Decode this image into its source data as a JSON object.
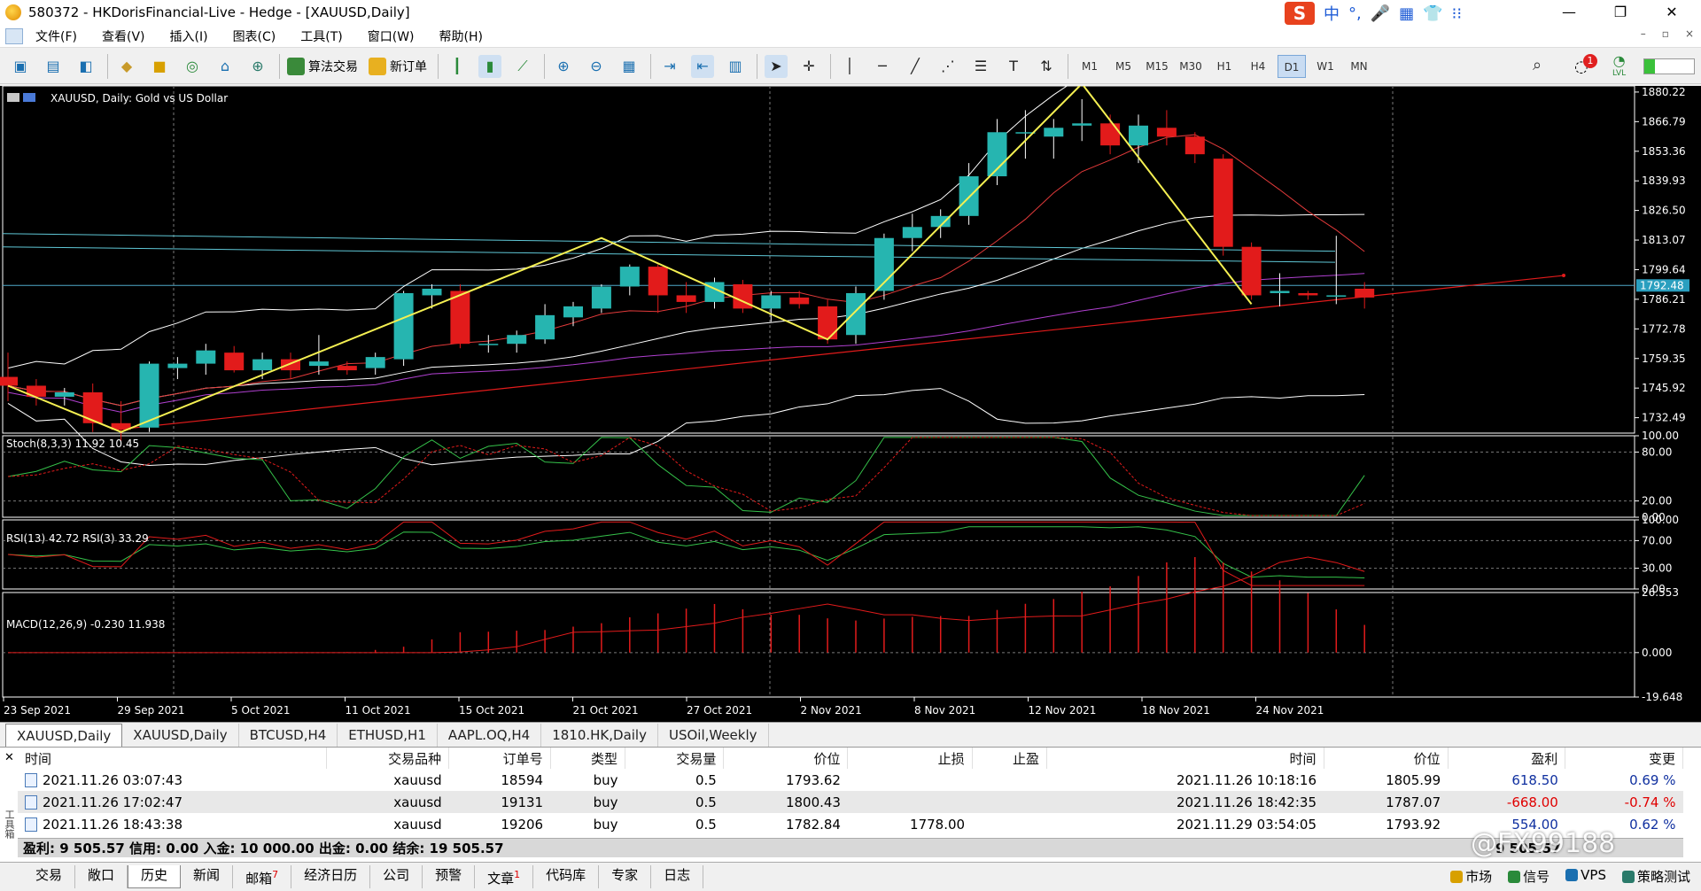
{
  "window": {
    "title": "580372 - HKDorisFinancial-Live - Hedge - [XAUUSD,Daily]",
    "minimize": "—",
    "restore": "❐",
    "close": "✕"
  },
  "ime": {
    "logo": "S",
    "items": [
      "中",
      "°,",
      "🎤",
      "▦",
      "👕",
      "⁝⁝"
    ]
  },
  "menu": [
    "文件(F)",
    "查看(V)",
    "插入(I)",
    "图表(C)",
    "工具(T)",
    "窗口(W)",
    "帮助(H)"
  ],
  "mdi": [
    "–",
    "▫",
    "×"
  ],
  "toolbar": {
    "algo": "算法交易",
    "neworder": "新订单",
    "timeframes": [
      "M1",
      "M5",
      "M15",
      "M30",
      "H1",
      "H4",
      "D1",
      "W1",
      "MN"
    ],
    "active_tf": "D1",
    "alert_count": "1",
    "lvl": "LVL"
  },
  "chart": {
    "symbol_label": "XAUUSD, Daily:  Gold vs US Dollar",
    "current_price": "1792.48",
    "price_ticks": [
      "1880.22",
      "1866.79",
      "1853.36",
      "1839.93",
      "1826.50",
      "1813.07",
      "1799.64",
      "1786.21",
      "1772.78",
      "1759.35",
      "1745.92",
      "1732.49"
    ],
    "date_ticks": [
      "23 Sep 2021",
      "29 Sep 2021",
      "5 Oct 2021",
      "11 Oct 2021",
      "15 Oct 2021",
      "21 Oct 2021",
      "27 Oct 2021",
      "2 Nov 2021",
      "8 Nov 2021",
      "12 Nov 2021",
      "18 Nov 2021",
      "24 Nov 2021"
    ],
    "stoch": {
      "label": "Stoch(8,3,3) 11.92 10.45",
      "ticks": [
        "100.00",
        "80.00",
        "20.00",
        "0.00"
      ]
    },
    "rsi": {
      "label": "RSI(13) 42.72 RSI(3) 33.29",
      "ticks": [
        "100.00",
        "70.00",
        "30.00",
        "0.00"
      ]
    },
    "macd": {
      "label": "MACD(12,26,9) -0.230 11.938",
      "ticks": [
        "26.553",
        "0.000",
        "-19.648"
      ]
    },
    "candles": [
      [
        1751,
        1762,
        1740,
        1747
      ],
      [
        1747,
        1750,
        1738,
        1742
      ],
      [
        1742,
        1746,
        1738,
        1744
      ],
      [
        1744,
        1748,
        1726,
        1730
      ],
      [
        1730,
        1740,
        1722,
        1727
      ],
      [
        1728,
        1758,
        1726,
        1757
      ],
      [
        1755,
        1760,
        1750,
        1757
      ],
      [
        1757,
        1766,
        1752,
        1763
      ],
      [
        1762,
        1765,
        1753,
        1754
      ],
      [
        1754,
        1762,
        1750,
        1759
      ],
      [
        1759,
        1762,
        1750,
        1754
      ],
      [
        1756,
        1770,
        1752,
        1758
      ],
      [
        1756,
        1758,
        1752,
        1754
      ],
      [
        1755,
        1762,
        1752,
        1760
      ],
      [
        1759,
        1790,
        1756,
        1789
      ],
      [
        1788,
        1793,
        1782,
        1791
      ],
      [
        1790,
        1793,
        1764,
        1766
      ],
      [
        1766,
        1770,
        1762,
        1766
      ],
      [
        1766,
        1772,
        1762,
        1770
      ],
      [
        1768,
        1784,
        1766,
        1779
      ],
      [
        1778,
        1785,
        1774,
        1783
      ],
      [
        1782,
        1793,
        1780,
        1792
      ],
      [
        1792,
        1802,
        1788,
        1801
      ],
      [
        1801,
        1802,
        1780,
        1788
      ],
      [
        1788,
        1794,
        1780,
        1785
      ],
      [
        1785,
        1796,
        1782,
        1794
      ],
      [
        1793,
        1795,
        1780,
        1782
      ],
      [
        1782,
        1790,
        1776,
        1788
      ],
      [
        1787,
        1790,
        1782,
        1784
      ],
      [
        1783,
        1786,
        1766,
        1768
      ],
      [
        1770,
        1792,
        1766,
        1789
      ],
      [
        1790,
        1816,
        1786,
        1814
      ],
      [
        1814,
        1825,
        1808,
        1819
      ],
      [
        1819,
        1827,
        1814,
        1824
      ],
      [
        1824,
        1848,
        1820,
        1842
      ],
      [
        1842,
        1868,
        1838,
        1862
      ],
      [
        1862,
        1872,
        1850,
        1862
      ],
      [
        1860,
        1868,
        1850,
        1864
      ],
      [
        1865,
        1877,
        1858,
        1866
      ],
      [
        1866,
        1870,
        1852,
        1856
      ],
      [
        1856,
        1870,
        1848,
        1865
      ],
      [
        1864,
        1872,
        1856,
        1860
      ],
      [
        1860,
        1862,
        1848,
        1852
      ],
      [
        1850,
        1852,
        1806,
        1810
      ],
      [
        1810,
        1812,
        1786,
        1788
      ],
      [
        1789,
        1798,
        1783,
        1790
      ],
      [
        1789,
        1790,
        1786,
        1788
      ],
      [
        1788,
        1815,
        1784,
        1788
      ],
      [
        1791,
        1794,
        1782,
        1787
      ]
    ]
  },
  "chart_tabs": [
    "XAUUSD,Daily",
    "XAUUSD,Daily",
    "BTCUSD,H4",
    "ETHUSD,H1",
    "AAPL.OQ,H4",
    "1810.HK,Daily",
    "USOil,Weekly"
  ],
  "history": {
    "columns": [
      "时间",
      "交易品种",
      "订单号",
      "类型",
      "交易量",
      "价位",
      "止损",
      "止盈",
      "时间",
      "价位",
      "盈利",
      "变更"
    ],
    "rows": [
      {
        "open_time": "2021.11.26 03:07:43",
        "symbol": "xauusd",
        "order": "18594",
        "type": "buy",
        "volume": "0.5",
        "open_price": "1793.62",
        "sl": "",
        "tp": "",
        "close_time": "2021.11.26 10:18:16",
        "close_price": "1805.99",
        "profit": "618.50",
        "change": "0.69 %"
      },
      {
        "open_time": "2021.11.26 17:02:47",
        "symbol": "xauusd",
        "order": "19131",
        "type": "buy",
        "volume": "0.5",
        "open_price": "1800.43",
        "sl": "",
        "tp": "",
        "close_time": "2021.11.26 18:42:35",
        "close_price": "1787.07",
        "profit": "-668.00",
        "change": "-0.74 %"
      },
      {
        "open_time": "2021.11.26 18:43:38",
        "symbol": "xauusd",
        "order": "19206",
        "type": "buy",
        "volume": "0.5",
        "open_price": "1782.84",
        "sl": "1778.00",
        "tp": "",
        "close_time": "2021.11.29 03:54:05",
        "close_price": "1793.92",
        "profit": "554.00",
        "change": "0.62 %"
      }
    ],
    "summary": "盈利: 9 505.57  信用: 0.00  入金: 10 000.00  出金: 0.00  结余: 19 505.57",
    "summary_tail": "9 505.57"
  },
  "bottom_tabs": [
    {
      "label": "交易"
    },
    {
      "label": "敞口"
    },
    {
      "label": "历史"
    },
    {
      "label": "新闻"
    },
    {
      "label": "邮箱",
      "badge": "7"
    },
    {
      "label": "经济日历"
    },
    {
      "label": "公司"
    },
    {
      "label": "预警"
    },
    {
      "label": "文章",
      "badge": "1"
    },
    {
      "label": "代码库"
    },
    {
      "label": "专家"
    },
    {
      "label": "日志"
    }
  ],
  "active_bottom_tab": "历史",
  "side_label": "工具箱",
  "status": [
    "市场",
    "信号",
    "VPS",
    "策略测试"
  ],
  "watermark": "@FX99188",
  "colors": {
    "bull": "#26b5b0",
    "bear": "#e21b1b",
    "zigzag": "#f5f052",
    "grid": "#7a7a7a"
  }
}
